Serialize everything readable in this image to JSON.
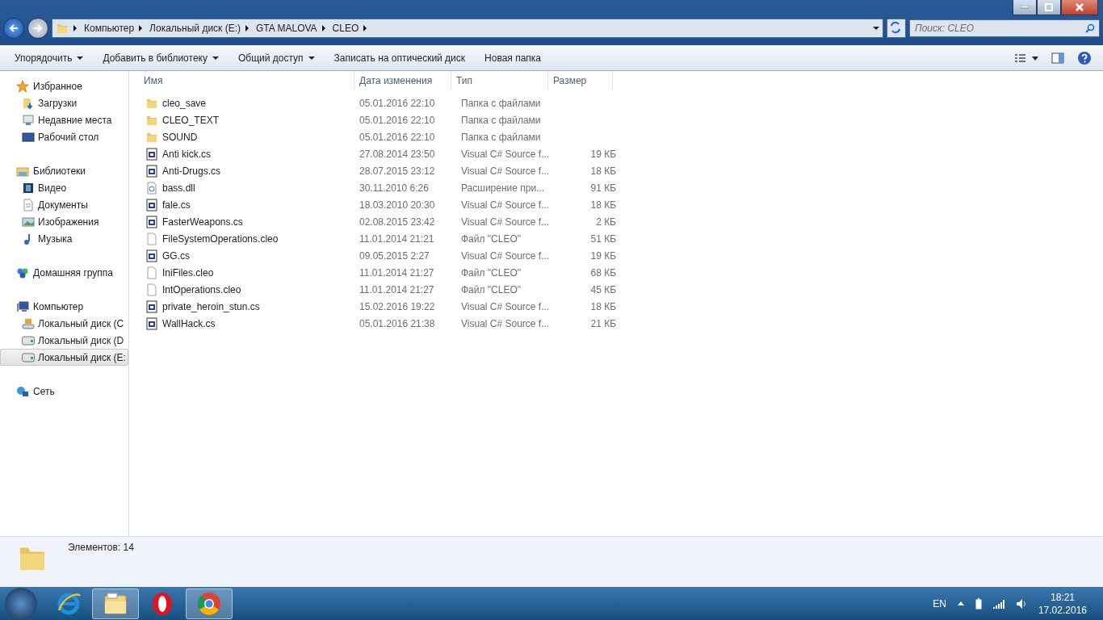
{
  "address_bar": {
    "breadcrumbs": [
      "Компьютер",
      "Локальный диск (E:)",
      "GTA MALOVA",
      "CLEO"
    ]
  },
  "search": {
    "placeholder": "Поиск: CLEO"
  },
  "toolbar": {
    "buttons": [
      {
        "label": "Упорядочить",
        "dropdown": true
      },
      {
        "label": "Добавить в библиотеку",
        "dropdown": true
      },
      {
        "label": "Общий доступ",
        "dropdown": true
      },
      {
        "label": "Записать на оптический диск",
        "dropdown": false
      },
      {
        "label": "Новая папка",
        "dropdown": false
      }
    ]
  },
  "sidebar": {
    "groups": [
      {
        "label": "Избранное",
        "kind": "star",
        "children": [
          {
            "label": "Загрузки",
            "kind": "downloads",
            "selected": false
          },
          {
            "label": "Недавние места",
            "kind": "recent",
            "selected": false
          },
          {
            "label": "Рабочий стол",
            "kind": "desktop",
            "selected": false
          }
        ]
      },
      {
        "label": "Библиотеки",
        "kind": "library",
        "children": [
          {
            "label": "Видео",
            "kind": "video",
            "selected": false
          },
          {
            "label": "Документы",
            "kind": "document",
            "selected": false
          },
          {
            "label": "Изображения",
            "kind": "image",
            "selected": false
          },
          {
            "label": "Музыка",
            "kind": "music",
            "selected": false
          }
        ]
      },
      {
        "label": "Домашняя группа",
        "kind": "homegroup"
      },
      {
        "label": "Компьютер",
        "kind": "computer",
        "children": [
          {
            "label": "Локальный диск (C",
            "kind": "system-drive",
            "selected": false
          },
          {
            "label": "Локальный диск (D",
            "kind": "drive",
            "selected": false
          },
          {
            "label": "Локальный диск (E:",
            "kind": "drive",
            "selected": true
          }
        ]
      },
      {
        "label": "Сеть",
        "kind": "network"
      }
    ]
  },
  "table": {
    "columns": [
      "Имя",
      "Дата изменения",
      "Тип",
      "Размер"
    ],
    "rows": [
      {
        "kind": "folder",
        "name": "cleo_save",
        "date": "05.01.2016 22:10",
        "type": "Папка с файлами"
      },
      {
        "kind": "folder",
        "name": "CLEO_TEXT",
        "date": "05.01.2016 22:10",
        "type": "Папка с файлами"
      },
      {
        "kind": "folder",
        "name": "SOUND",
        "date": "05.01.2016 22:10",
        "type": "Папка с файлами"
      },
      {
        "kind": "cs",
        "name": "Anti kick.cs",
        "date": "27.08.2014 23:50",
        "type": "Visual C# Source f...",
        "size": "19 КБ"
      },
      {
        "kind": "cs",
        "name": "Anti-Drugs.cs",
        "date": "28.07.2015 23:12",
        "type": "Visual C# Source f...",
        "size": "18 КБ"
      },
      {
        "kind": "dll",
        "name": "bass.dll",
        "date": "30.11.2010 6:26",
        "type": "Расширение при...",
        "size": "91 КБ"
      },
      {
        "kind": "cs",
        "name": "fale.cs",
        "date": "18.03.2010 20:30",
        "type": "Visual C# Source f...",
        "size": "18 КБ"
      },
      {
        "kind": "cs",
        "name": "FasterWeapons.cs",
        "date": "02.08.2015 23:42",
        "type": "Visual C# Source f...",
        "size": "2 КБ"
      },
      {
        "kind": "file",
        "name": "FileSystemOperations.cleo",
        "date": "11.01.2014 21:21",
        "type": "Файл \"CLEO\"",
        "size": "51 КБ"
      },
      {
        "kind": "cs",
        "name": "GG.cs",
        "date": "09.05.2015 2:27",
        "type": "Visual C# Source f...",
        "size": "19 КБ"
      },
      {
        "kind": "file",
        "name": "IniFiles.cleo",
        "date": "11.01.2014 21:27",
        "type": "Файл \"CLEO\"",
        "size": "68 КБ"
      },
      {
        "kind": "file",
        "name": "IntOperations.cleo",
        "date": "11.01.2014 21:27",
        "type": "Файл \"CLEO\"",
        "size": "45 КБ"
      },
      {
        "kind": "cs",
        "name": "private_heroin_stun.cs",
        "date": "15.02.2016 19:22",
        "type": "Visual C# Source f...",
        "size": "18 КБ"
      },
      {
        "kind": "cs",
        "name": "WallHack.cs",
        "date": "05.01.2016 21:38",
        "type": "Visual C# Source f...",
        "size": "21 КБ"
      }
    ]
  },
  "status_bar": {
    "text": "Элементов: 14"
  },
  "taskbar": {
    "apps": [
      {
        "kind": "ie",
        "running": false
      },
      {
        "kind": "explorer",
        "running": true
      },
      {
        "kind": "opera",
        "running": false
      },
      {
        "kind": "chrome",
        "running": true
      }
    ],
    "language": "EN",
    "time": "18:21",
    "date": "17.02.2016"
  }
}
